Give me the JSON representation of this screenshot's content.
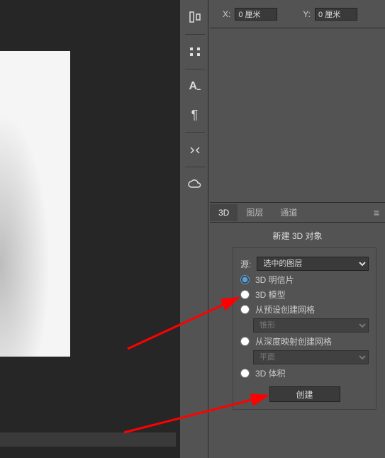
{
  "coords": {
    "x_label": "X:",
    "x_value": "0 厘米",
    "y_label": "Y:",
    "y_value": "0 厘米"
  },
  "tabs": {
    "t3d": "3D",
    "layers": "图层",
    "channels": "通道"
  },
  "panel": {
    "title": "新建 3D 对象",
    "source_label": "源:",
    "source_value": "选中的图层",
    "opt_postcard": "3D 明信片",
    "opt_model": "3D 模型",
    "opt_preset": "从预设创建网格",
    "preset_shape": "锥形",
    "opt_depth": "从深度映射创建网格",
    "depth_shape": "平面",
    "opt_volume": "3D 体积",
    "create_btn": "创建"
  },
  "tools": {
    "t1": "align-icon",
    "t2": "distribute-icon",
    "t3": "text-a-icon",
    "t4": "paragraph-icon",
    "t5": "tools-icon",
    "t6": "cloud-icon"
  }
}
